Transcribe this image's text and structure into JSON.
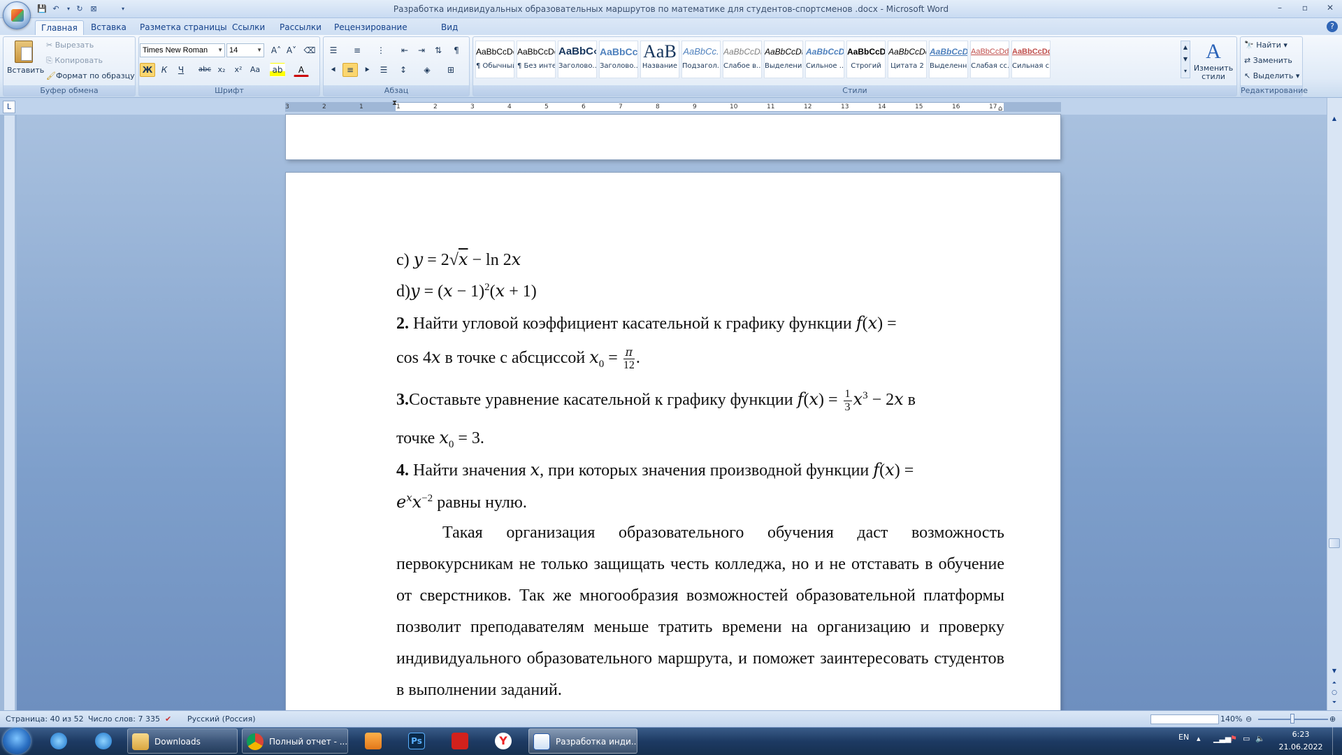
{
  "window": {
    "title": "Разработка индивидуальных образовательных маршрутов по математике для студентов-спортсменов .docx - Microsoft Word"
  },
  "tabs": [
    "Главная",
    "Вставка",
    "Разметка страницы",
    "Ссылки",
    "Рассылки",
    "Рецензирование",
    "Вид"
  ],
  "ribbon": {
    "clipboard": {
      "paste": "Вставить",
      "cut": "Вырезать",
      "copy": "Копировать",
      "format_painter": "Формат по образцу",
      "label": "Буфер обмена"
    },
    "font": {
      "name": "Times New Roman",
      "size": "14",
      "label": "Шрифт"
    },
    "paragraph": {
      "label": "Абзац"
    },
    "styles": {
      "label": "Стили",
      "items": [
        {
          "preview": "AaBbCcDc",
          "name": "¶ Обычный"
        },
        {
          "preview": "AaBbCcDc",
          "name": "¶ Без инте..."
        },
        {
          "preview": "AaBbC‹",
          "name": "Заголово..."
        },
        {
          "preview": "AaBbCc",
          "name": "Заголово..."
        },
        {
          "preview": "AaB",
          "name": "Название"
        },
        {
          "preview": "AaBbCc.",
          "name": "Подзагол..."
        },
        {
          "preview": "AaBbCcDt",
          "name": "Слабое в..."
        },
        {
          "preview": "AaBbCcDt",
          "name": "Выделение"
        },
        {
          "preview": "AaBbCcDt",
          "name": "Сильное ..."
        },
        {
          "preview": "AaBbCcDc",
          "name": "Строгий"
        },
        {
          "preview": "AaBbCcDc",
          "name": "Цитата 2"
        },
        {
          "preview": "AaBbCcDc",
          "name": "Выделенн..."
        },
        {
          "preview": "AaBbCcDd",
          "name": "Слабая сс..."
        },
        {
          "preview": "AaBbCcDd",
          "name": "Сильная с..."
        }
      ],
      "change_styles": "Изменить стили"
    },
    "editing": {
      "find": "Найти",
      "replace": "Заменить",
      "select": "Выделить",
      "label": "Редактирование"
    }
  },
  "ruler": {
    "ticks": [
      "3",
      "2",
      "1",
      "1",
      "2",
      "3",
      "4",
      "5",
      "6",
      "7",
      "8",
      "9",
      "10",
      "11",
      "12",
      "13",
      "14",
      "15",
      "16",
      "17"
    ]
  },
  "document": {
    "line_c_prefix": "c) ",
    "line_d_prefix": "d)",
    "task2_num": "2.",
    "task2_text": " Найти угловой коэффициент касательной к графику функции ",
    "task2_text2": " в точке с абсциссой ",
    "task3_num": "3.",
    "task3_text": "Составьте уравнение касательной к графику функции ",
    "task3_text2": " в",
    "task3_line2": "точке ",
    "task4_num": "4.",
    "task4_text": " Найти значения ",
    "task4_text2": ", при которых значения производной функции ",
    "task4_line2": " равны нулю.",
    "paragraph": "Такая организация образовательного обучения даст возможность первокурсникам не только защищать честь колледжа, но и не отставать в обучение от сверстников. Так же многообразия возможностей образовательной платформы позволит преподавателям меньше тратить времени на организацию и проверку индивидуального образовательного маршрута, и поможет заинтересовать студентов в выполнении заданий."
  },
  "status": {
    "page": "Страница: 40 из 52",
    "words": "Число слов: 7 335",
    "language": "Русский (Россия)",
    "zoom": "140%"
  },
  "taskbar": {
    "downloads": "Downloads",
    "chrome": "Полный отчет - ...",
    "word": "Разработка инди...",
    "lang": "EN",
    "time": "6:23",
    "date": "21.06.2022"
  }
}
